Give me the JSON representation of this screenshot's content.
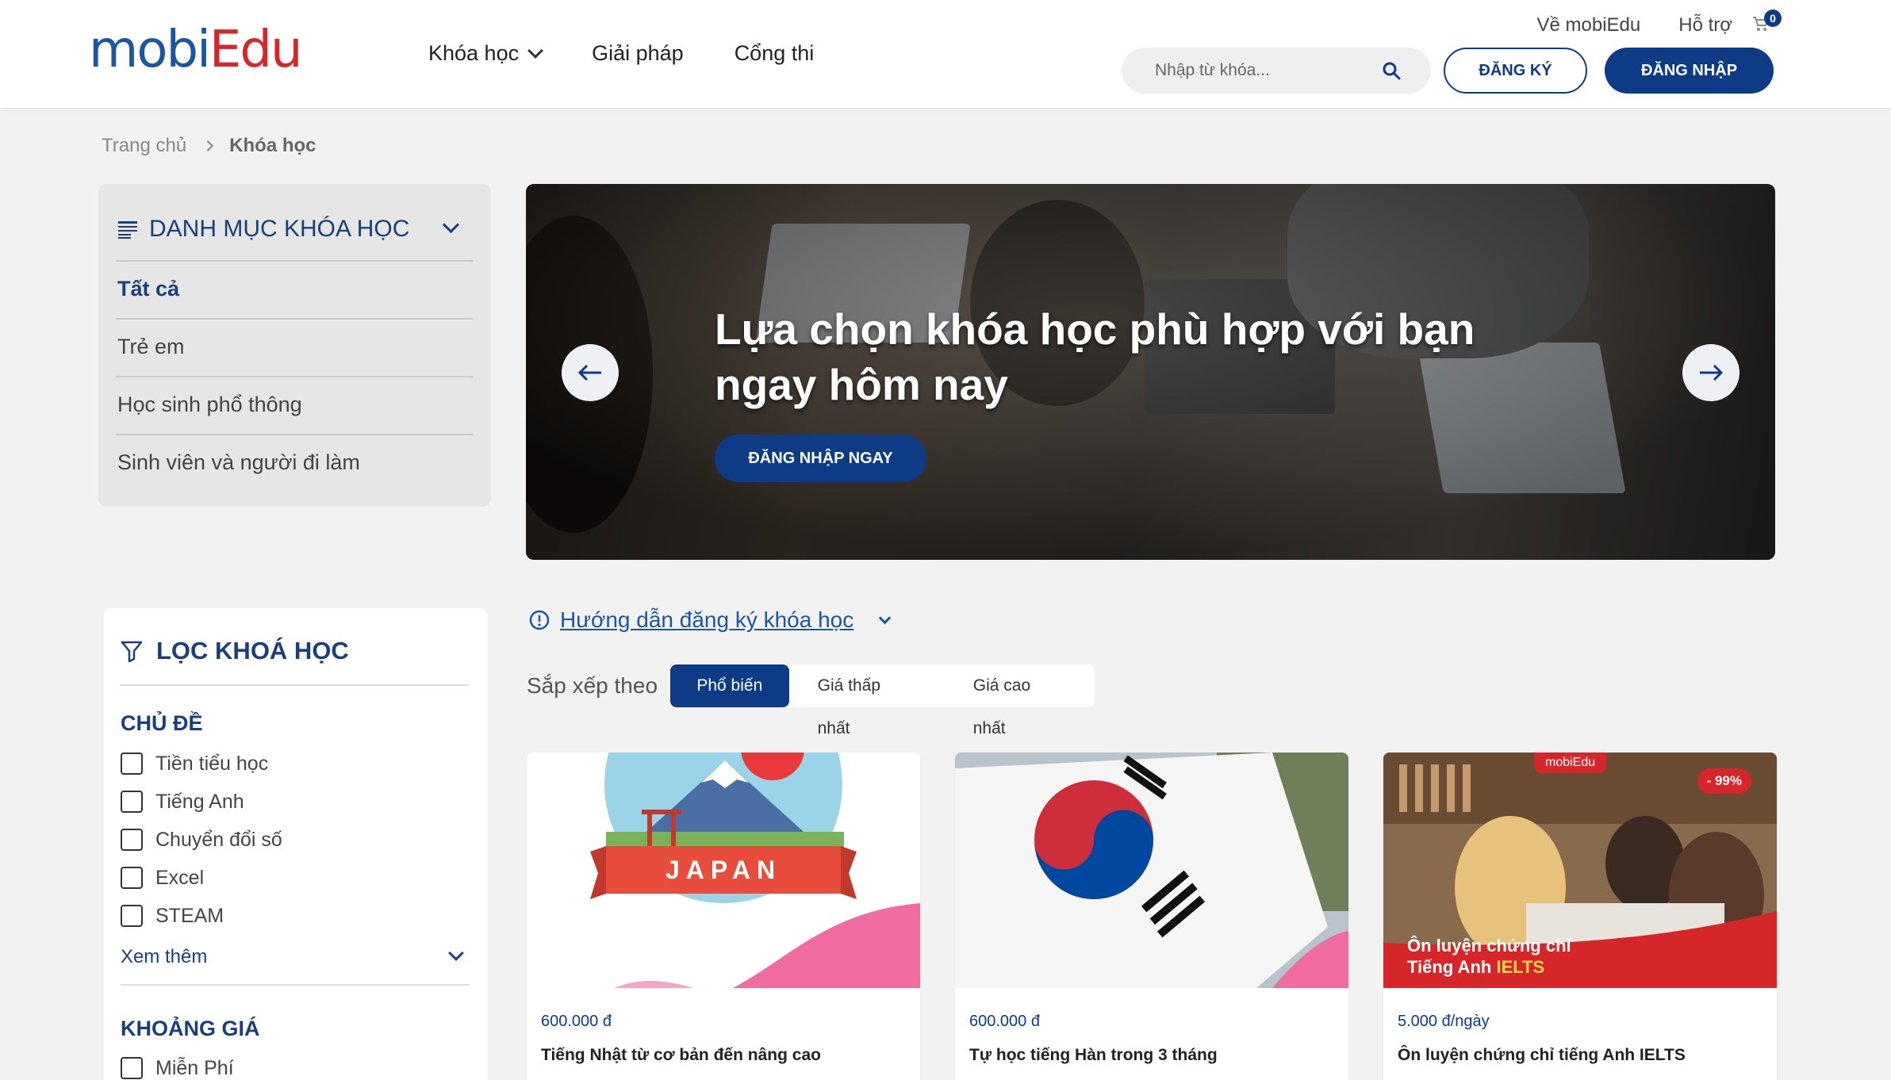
{
  "header": {
    "logo": {
      "part1": "mobi",
      "part2": "Edu"
    },
    "nav": [
      {
        "label": "Khóa học",
        "dropdown": true
      },
      {
        "label": "Giải pháp",
        "dropdown": false
      },
      {
        "label": "Cổng thi",
        "dropdown": false
      }
    ],
    "top_links": [
      "Về mobiEdu",
      "Hỗ trợ"
    ],
    "cart_count": "0",
    "search_placeholder": "Nhập từ khóa...",
    "register_label": "ĐĂNG KÝ",
    "login_label": "ĐĂNG NHẬP"
  },
  "breadcrumb": [
    "Trang chủ",
    "Khóa học"
  ],
  "category": {
    "title": "DANH MỤC KHÓA HỌC",
    "items": [
      "Tất cả",
      "Trẻ em",
      "Học sinh phổ thông",
      "Sinh viên và người đi làm"
    ]
  },
  "hero": {
    "title": "Lựa chọn khóa học phù hợp với bạn ngay hôm nay",
    "cta": "ĐĂNG NHẬP NGAY"
  },
  "guide": {
    "label": "Hướng dẫn đăng ký khóa học"
  },
  "sort": {
    "label": "Sắp xếp theo",
    "options": [
      "Phổ biến",
      "Giá thấp nhất",
      "Giá cao nhất"
    ],
    "selected": "Phổ biến"
  },
  "filter": {
    "title": "LỌC KHOÁ HỌC",
    "topic_title": "CHỦ ĐỀ",
    "topics": [
      "Tiền tiểu học",
      "Tiếng Anh",
      "Chuyển đổi số",
      "Excel",
      "STEAM"
    ],
    "more_label": "Xem thêm",
    "price_title": "KHOẢNG GIÁ",
    "prices": [
      "Miễn Phí"
    ]
  },
  "courses": [
    {
      "price": "600.000 đ",
      "title": "Tiếng Nhật từ cơ bản đến nâng cao",
      "image_text": "JAPAN"
    },
    {
      "price": "600.000 đ",
      "title": "Tự học tiếng Hàn trong 3 tháng"
    },
    {
      "price": "5.000 đ/ngày",
      "title": "Ôn luyện chứng chỉ tiếng Anh IELTS",
      "badge": "- 99%",
      "brand": "mobiEdu",
      "image_line1": "Ôn luyện chứng chỉ",
      "image_line2a": "Tiếng Anh ",
      "image_line2b": "IELTS"
    }
  ],
  "colors": {
    "primary": "#0d3b85",
    "brand_blue": "#1a56a3",
    "brand_red": "#d7262a",
    "background": "#f2f2f2"
  }
}
